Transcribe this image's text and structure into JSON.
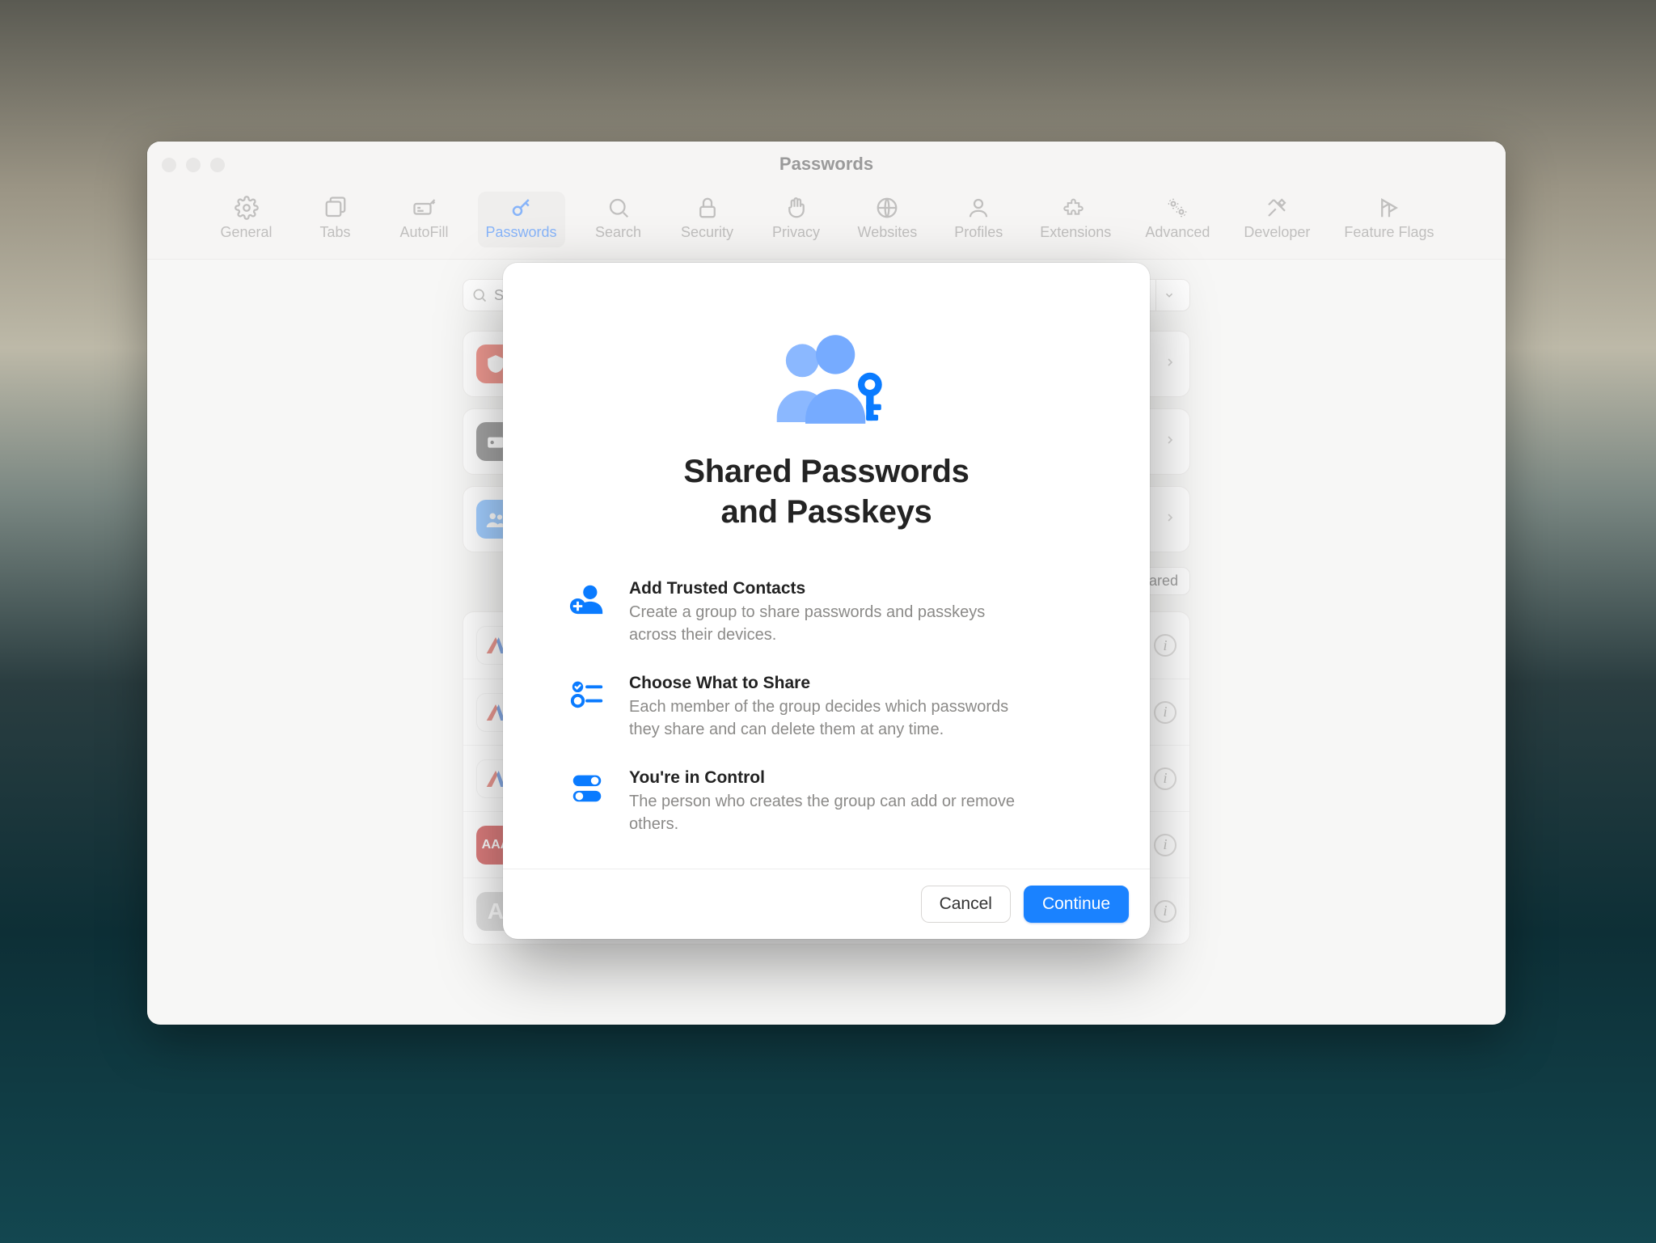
{
  "window": {
    "title": "Passwords",
    "tabs": [
      {
        "label": "General",
        "icon": "gear-icon"
      },
      {
        "label": "Tabs",
        "icon": "tabs-icon"
      },
      {
        "label": "AutoFill",
        "icon": "autofill-icon"
      },
      {
        "label": "Passwords",
        "icon": "key-icon",
        "active": true
      },
      {
        "label": "Search",
        "icon": "search-icon"
      },
      {
        "label": "Security",
        "icon": "lock-icon"
      },
      {
        "label": "Privacy",
        "icon": "hand-icon"
      },
      {
        "label": "Websites",
        "icon": "globe-icon"
      },
      {
        "label": "Profiles",
        "icon": "person-icon"
      },
      {
        "label": "Extensions",
        "icon": "puzzle-icon"
      },
      {
        "label": "Advanced",
        "icon": "gears-icon"
      },
      {
        "label": "Developer",
        "icon": "tools-icon"
      },
      {
        "label": "Feature Flags",
        "icon": "flags-icon"
      }
    ],
    "search_placeholder": "Search",
    "shared_badge": "Shared",
    "list_icon_colors": [
      "#e24a3b",
      "#5b5b5b",
      "#5aa8ff",
      "#fff",
      "#d9483b",
      "#d9483b",
      "#d9483b",
      "#c01818",
      "#c9c9c9"
    ]
  },
  "modal": {
    "title_line1": "Shared Passwords",
    "title_line2": "and Passkeys",
    "features": [
      {
        "title": "Add Trusted Contacts",
        "desc": "Create a group to share passwords and passkeys across their devices.",
        "icon": "person-add-icon"
      },
      {
        "title": "Choose What to Share",
        "desc": "Each member of the group decides which passwords they share and can delete them at any time.",
        "icon": "checklist-icon"
      },
      {
        "title": "You're in Control",
        "desc": "The person who creates the group can add or remove others.",
        "icon": "toggles-icon"
      }
    ],
    "cancel_label": "Cancel",
    "continue_label": "Continue"
  },
  "colors": {
    "accent": "#1a82ff"
  }
}
